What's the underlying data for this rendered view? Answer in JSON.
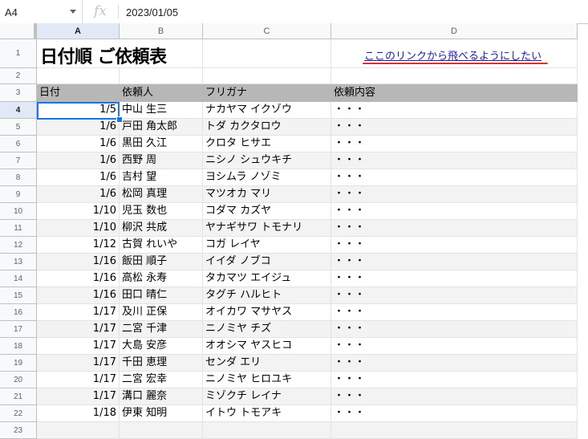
{
  "formula_bar": {
    "cell_ref": "A4",
    "fx": "fx",
    "content": "2023/01/05"
  },
  "columns": [
    "A",
    "B",
    "C",
    "D"
  ],
  "row_numbers": [
    "1",
    "2",
    "3",
    "4",
    "5",
    "6",
    "7",
    "8",
    "9",
    "10",
    "11",
    "12",
    "13",
    "14",
    "15",
    "16",
    "17",
    "18",
    "19",
    "20",
    "21",
    "22",
    "23"
  ],
  "sheet": {
    "title": "日付順 ご依頼表",
    "link_text": "ここのリンクから飛べるようにしたい",
    "annotation_color": "#d8342e",
    "header": {
      "date": "日付",
      "client": "依頼人",
      "furigana": "フリガナ",
      "content": "依頼内容"
    },
    "header_bg": "#b7b7b7",
    "rows": [
      {
        "date": "1/5",
        "client": "中山 生三",
        "furigana": "ナカヤマ イクゾウ",
        "content": "・・・"
      },
      {
        "date": "1/6",
        "client": "戸田 角太郎",
        "furigana": "トダ カクタロウ",
        "content": "・・・"
      },
      {
        "date": "1/6",
        "client": "黒田 久江",
        "furigana": "クロタ ヒサエ",
        "content": "・・・"
      },
      {
        "date": "1/6",
        "client": "西野 周",
        "furigana": "ニシノ シュウキチ",
        "content": "・・・"
      },
      {
        "date": "1/6",
        "client": "吉村 望",
        "furigana": "ヨシムラ ノゾミ",
        "content": "・・・"
      },
      {
        "date": "1/6",
        "client": "松岡 真理",
        "furigana": "マツオカ マリ",
        "content": "・・・"
      },
      {
        "date": "1/10",
        "client": "児玉 数也",
        "furigana": "コダマ カズヤ",
        "content": "・・・"
      },
      {
        "date": "1/10",
        "client": "柳沢 共成",
        "furigana": "ヤナギサワ トモナリ",
        "content": "・・・"
      },
      {
        "date": "1/12",
        "client": "古賀 れいや",
        "furigana": "コガ レイヤ",
        "content": "・・・"
      },
      {
        "date": "1/16",
        "client": "飯田 順子",
        "furigana": "イイダ ノブコ",
        "content": "・・・"
      },
      {
        "date": "1/16",
        "client": "高松 永寿",
        "furigana": "タカマツ エイジュ",
        "content": "・・・"
      },
      {
        "date": "1/16",
        "client": "田口 晴仁",
        "furigana": "タグチ ハルヒト",
        "content": "・・・"
      },
      {
        "date": "1/17",
        "client": "及川 正保",
        "furigana": "オイカワ マサヤス",
        "content": "・・・"
      },
      {
        "date": "1/17",
        "client": "二宮 千津",
        "furigana": "ニノミヤ チズ",
        "content": "・・・"
      },
      {
        "date": "1/17",
        "client": "大島 安彦",
        "furigana": "オオシマ ヤスヒコ",
        "content": "・・・"
      },
      {
        "date": "1/17",
        "client": "千田 恵理",
        "furigana": "センダ エリ",
        "content": "・・・"
      },
      {
        "date": "1/17",
        "client": "二宮 宏幸",
        "furigana": "ニノミヤ ヒロユキ",
        "content": "・・・"
      },
      {
        "date": "1/17",
        "client": "溝口 麗奈",
        "furigana": "ミゾクチ レイナ",
        "content": "・・・"
      },
      {
        "date": "1/18",
        "client": "伊東 知明",
        "furigana": "イトウ トモアキ",
        "content": "・・・"
      }
    ]
  }
}
